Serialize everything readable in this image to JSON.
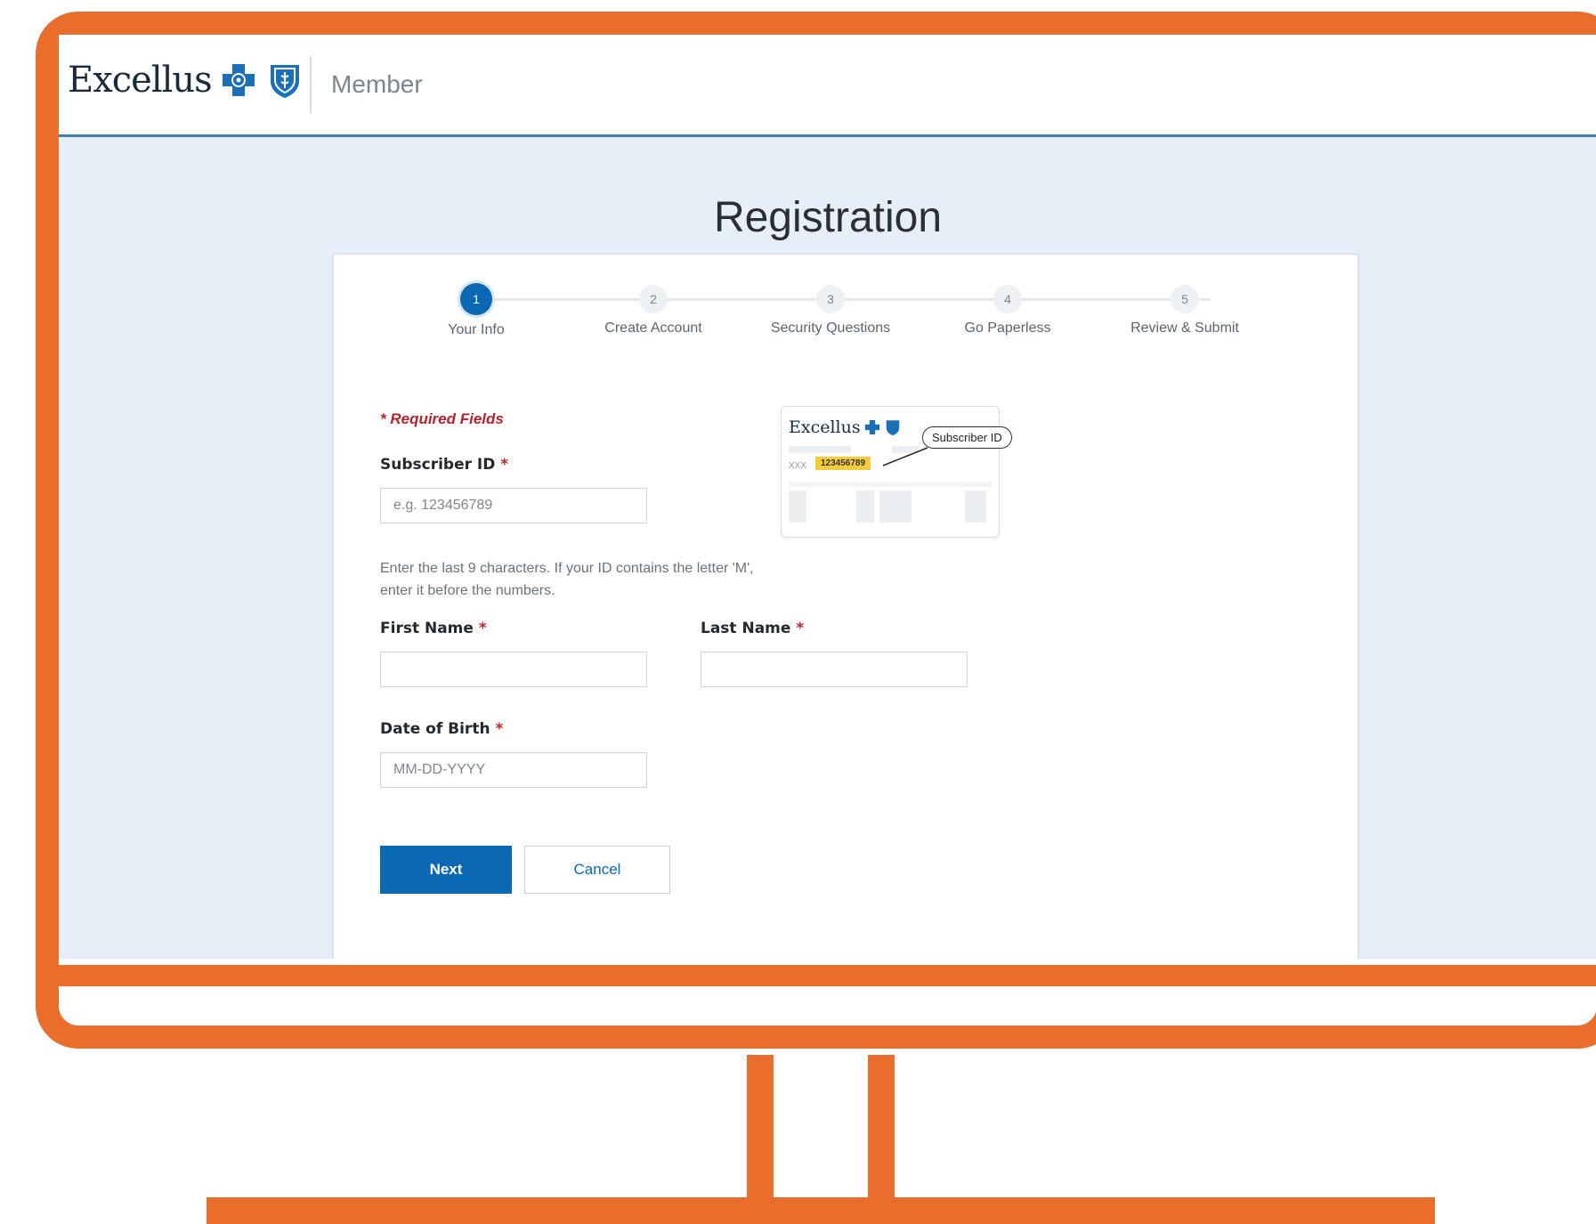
{
  "header": {
    "brand": "Excellus",
    "section": "Member"
  },
  "page": {
    "title": "Registration"
  },
  "stepper": {
    "steps": [
      {
        "number": "1",
        "label": "Your Info",
        "active": true
      },
      {
        "number": "2",
        "label": "Create Account",
        "active": false
      },
      {
        "number": "3",
        "label": "Security Questions",
        "active": false
      },
      {
        "number": "4",
        "label": "Go Paperless",
        "active": false
      },
      {
        "number": "5",
        "label": "Review & Submit",
        "active": false
      }
    ]
  },
  "form": {
    "required_note": "* Required Fields",
    "subscriber_id": {
      "label": "Subscriber ID",
      "required_mark": "*",
      "placeholder": "e.g. 123456789",
      "value": "",
      "helper": "Enter the last 9 characters. If your ID contains the letter 'M', enter it before the numbers."
    },
    "first_name": {
      "label": "First Name",
      "required_mark": "*",
      "value": ""
    },
    "last_name": {
      "label": "Last Name",
      "required_mark": "*",
      "value": ""
    },
    "dob": {
      "label": "Date of Birth",
      "required_mark": "*",
      "placeholder": "MM-DD-YYYY",
      "value": ""
    },
    "next_label": "Next",
    "cancel_label": "Cancel"
  },
  "id_card": {
    "brand": "Excellus",
    "prefix": "XXX",
    "number": "123456789",
    "callout": "Subscriber ID"
  },
  "colors": {
    "frame": "#e96d2b",
    "primary": "#0b68b3",
    "required": "#b3232d",
    "screen_bg": "#e6eff8"
  },
  "icons": [
    "bcbs-cross-icon",
    "bcbs-shield-icon"
  ]
}
